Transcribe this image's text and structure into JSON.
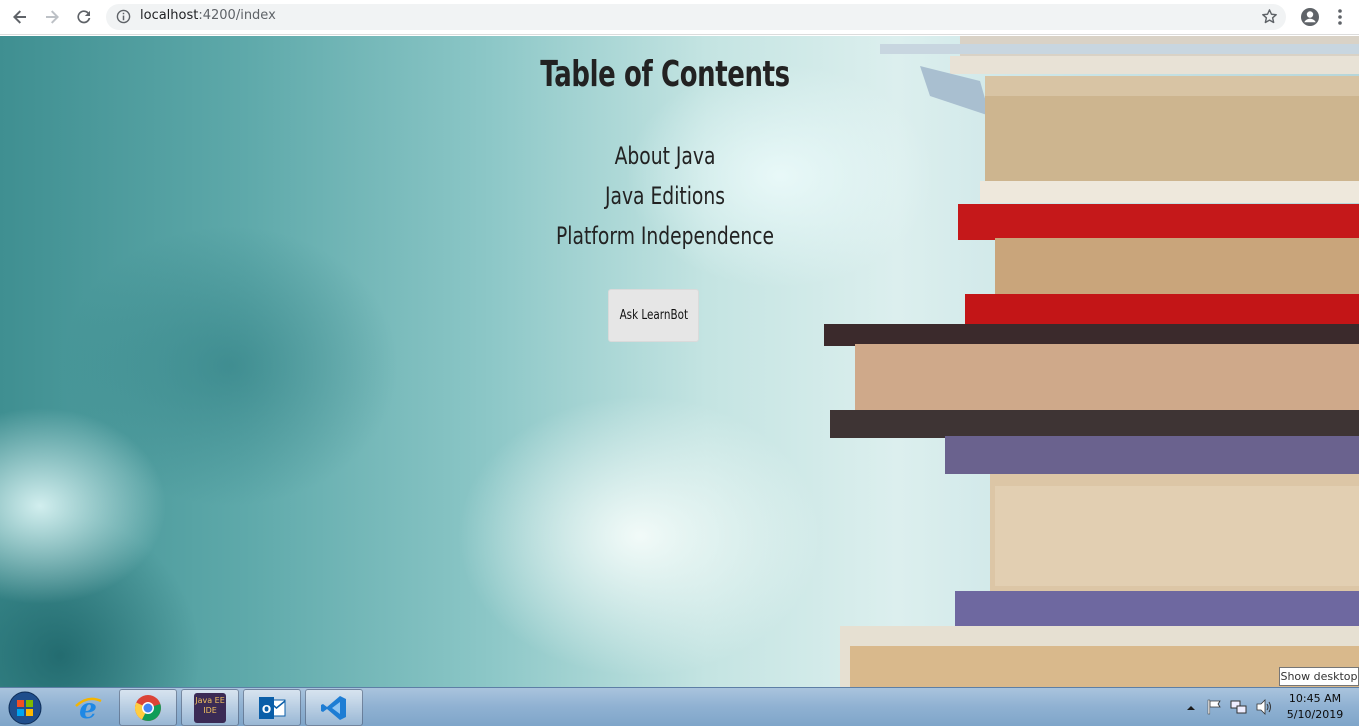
{
  "browser": {
    "url_host": "localhost",
    "url_path": ":4200/index"
  },
  "page": {
    "title": "Table of Contents",
    "links": [
      {
        "label": "About Java"
      },
      {
        "label": "Java Editions"
      },
      {
        "label": "Platform Independence"
      }
    ],
    "ask_button": "Ask LearnBot"
  },
  "taskbar": {
    "apps": [
      "start",
      "internet-explorer",
      "chrome",
      "java-ee-ide",
      "outlook",
      "visual-studio-code"
    ],
    "java_ee_icon_text": "Java EE IDE",
    "clock_time": "10:45 AM",
    "clock_date": "5/10/2019",
    "tooltip": "Show desktop"
  },
  "colors": {
    "taskbar": "#8fb1d2",
    "button_bg": "#e6e6e6",
    "text": "#222222"
  }
}
